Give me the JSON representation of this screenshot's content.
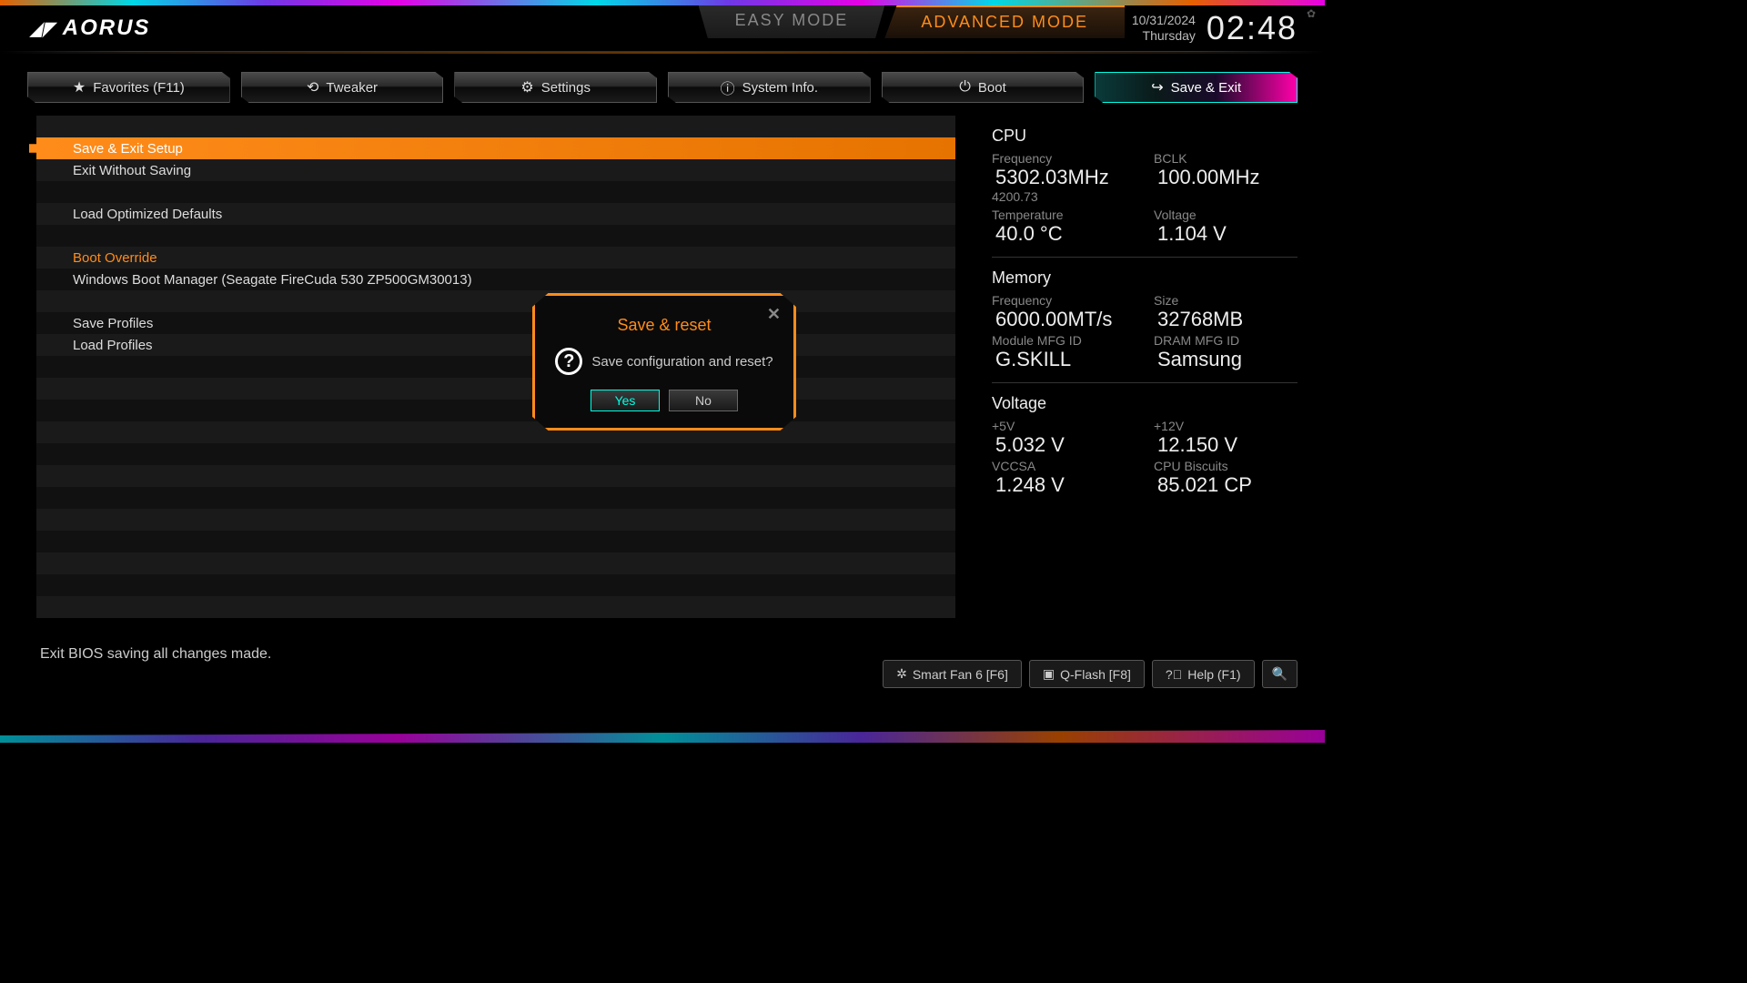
{
  "header": {
    "logo": "AORUS",
    "mode_easy": "EASY MODE",
    "mode_adv": "ADVANCED MODE",
    "date": "10/31/2024",
    "day": "Thursday",
    "time": "02:48"
  },
  "nav": [
    {
      "label": "Favorites (F11)",
      "icon": "★"
    },
    {
      "label": "Tweaker",
      "icon": "⟲"
    },
    {
      "label": "Settings",
      "icon": "⚙"
    },
    {
      "label": "System Info.",
      "icon": "ⓘ"
    },
    {
      "label": "Boot",
      "icon": "⏻"
    },
    {
      "label": "Save & Exit",
      "icon": "↪"
    }
  ],
  "menu": {
    "items": [
      "Save & Exit Setup",
      "Exit Without Saving",
      "Load Optimized Defaults",
      "Boot Override",
      "Windows Boot Manager (Seagate FireCuda 530 ZP500GM30013)",
      "Save Profiles",
      "Load Profiles"
    ]
  },
  "sidebar": {
    "cpu": {
      "title": "CPU",
      "freq_label": "Frequency",
      "freq": "5302.03MHz",
      "freq_sub": "4200.73",
      "bclk_label": "BCLK",
      "bclk": "100.00MHz",
      "temp_label": "Temperature",
      "temp": "40.0 °C",
      "volt_label": "Voltage",
      "volt": "1.104 V"
    },
    "mem": {
      "title": "Memory",
      "freq_label": "Frequency",
      "freq": "6000.00MT/s",
      "size_label": "Size",
      "size": "32768MB",
      "mod_label": "Module MFG ID",
      "mod": "G.SKILL",
      "dram_label": "DRAM MFG ID",
      "dram": "Samsung"
    },
    "volt": {
      "title": "Voltage",
      "v5_label": "+5V",
      "v5": "5.032 V",
      "v12_label": "+12V",
      "v12": "12.150 V",
      "vccsa_label": "VCCSA",
      "vccsa": "1.248 V",
      "cpub_label": "CPU Biscuits",
      "cpub": "85.021 CP"
    }
  },
  "help": "Exit BIOS saving all changes made.",
  "footer": {
    "fan": "Smart Fan 6 [F6]",
    "qflash": "Q-Flash [F8]",
    "help": "Help (F1)"
  },
  "dialog": {
    "title": "Save & reset",
    "msg": "Save configuration and reset?",
    "yes": "Yes",
    "no": "No"
  }
}
